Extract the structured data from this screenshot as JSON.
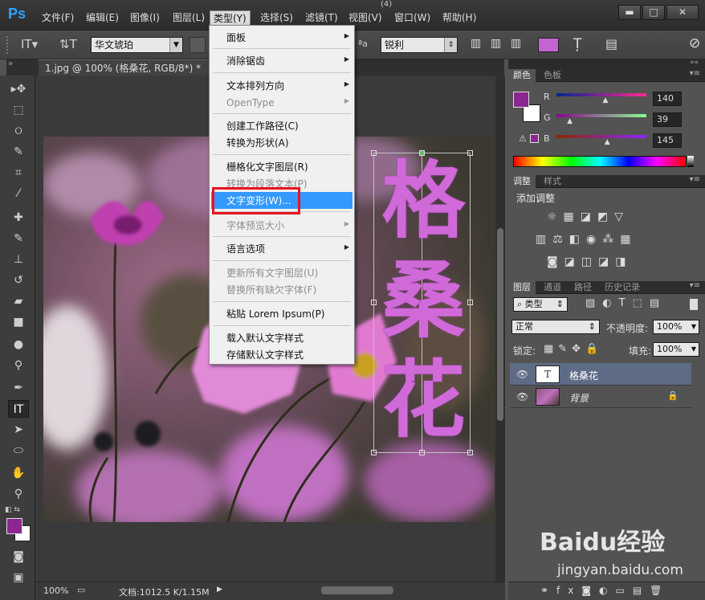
{
  "app": {
    "logo": "Ps",
    "title_number": "(4)"
  },
  "menu": [
    "文件(F)",
    "编辑(E)",
    "图像(I)",
    "图层(L)",
    "类型(Y)",
    "选择(S)",
    "滤镜(T)",
    "视图(V)",
    "窗口(W)",
    "帮助(H)"
  ],
  "window_controls": {
    "minimize": "▬",
    "restore": "□",
    "close": "✕"
  },
  "options": {
    "font_family": "华文琥珀",
    "antialias": "锐利",
    "aa_label": "ªa",
    "text_color": "#c464d2"
  },
  "document": {
    "tab": "1.jpg @ 100% (格桑花, RGB/8*) *",
    "close": "×"
  },
  "canvas_text": [
    "格",
    "桑",
    "花"
  ],
  "status": {
    "zoom": "100%",
    "doc_info": "文档:1012.5 K/1.15M"
  },
  "dropdown": {
    "items": [
      {
        "label": "面板",
        "disabled": false,
        "submenu": true
      },
      {
        "label": "消除锯齿",
        "disabled": false,
        "submenu": true
      },
      {
        "label": "文本排列方向",
        "disabled": false,
        "submenu": true
      },
      {
        "label": "OpenType",
        "disabled": true,
        "submenu": true
      },
      {
        "label": "创建工作路径(C)",
        "disabled": false,
        "submenu": false
      },
      {
        "label": "转换为形状(A)",
        "disabled": false,
        "submenu": false
      },
      {
        "label": "栅格化文字图层(R)",
        "disabled": false,
        "submenu": false
      },
      {
        "label": "转换为段落文本(P)",
        "disabled": true,
        "submenu": false
      },
      {
        "label": "文字变形(W)...",
        "disabled": false,
        "submenu": false,
        "highlighted": true
      },
      {
        "label": "字体预览大小",
        "disabled": true,
        "submenu": true
      },
      {
        "label": "语言选项",
        "disabled": false,
        "submenu": true
      },
      {
        "label": "更新所有文字图层(U)",
        "disabled": true,
        "submenu": false
      },
      {
        "label": "替换所有缺欠字体(F)",
        "disabled": true,
        "submenu": false
      },
      {
        "label": "粘贴 Lorem Ipsum(P)",
        "disabled": false,
        "submenu": false
      },
      {
        "label": "载入默认文字样式",
        "disabled": false,
        "submenu": false
      },
      {
        "label": "存储默认文字样式",
        "disabled": false,
        "submenu": false
      }
    ]
  },
  "color_panel": {
    "tabs": [
      "颜色",
      "色板"
    ],
    "r_label": "R",
    "g_label": "G",
    "b_label": "B",
    "r": "140",
    "g": "39",
    "b": "145",
    "r_frac": 0.549,
    "g_frac": 0.153,
    "b_frac": 0.569,
    "fg": "#8c2791",
    "bg": "#ffffff"
  },
  "adjust_panel": {
    "tabs": [
      "调整",
      "样式"
    ],
    "title": "添加调整"
  },
  "layers_panel": {
    "tabs": [
      "图层",
      "通道",
      "路径",
      "历史记录"
    ],
    "filter": "类型",
    "blend": "正常",
    "opacity_label": "不透明度:",
    "opacity": "100%",
    "lock_label": "锁定:",
    "fill_label": "填充:",
    "fill": "100%",
    "layers": [
      {
        "name": "格桑花",
        "type": "text",
        "selected": true
      },
      {
        "name": "背景",
        "type": "image",
        "selected": false
      }
    ]
  },
  "watermark": {
    "brand": "Baidu经验",
    "url": "jingyan.baidu.com"
  }
}
